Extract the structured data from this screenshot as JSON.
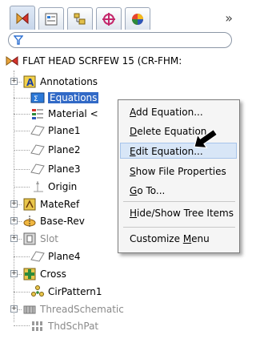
{
  "toolbar": {
    "tabs": [
      "feature-manager",
      "property-manager",
      "configuration-manager",
      "dimxpert-manager",
      "display-manager"
    ],
    "more_label": "»"
  },
  "tree": {
    "root_label": "FLAT HEAD SCRFEW 15  (CR-FHM:",
    "items": [
      {
        "label": "Annotations",
        "icon": "annotations-icon"
      },
      {
        "label": "Equations",
        "icon": "equations-icon",
        "selected": true
      },
      {
        "label": "Material <",
        "icon": "material-icon"
      },
      {
        "label": "Plane1",
        "icon": "plane-icon"
      },
      {
        "label": "Plane2",
        "icon": "plane-icon"
      },
      {
        "label": "Plane3",
        "icon": "plane-icon"
      },
      {
        "label": "Origin",
        "icon": "origin-icon"
      },
      {
        "label": "MateRef",
        "icon": "materef-icon"
      },
      {
        "label": "Base-Rev",
        "icon": "revolve-icon"
      },
      {
        "label": "Slot",
        "icon": "cut-icon"
      },
      {
        "label": "Plane4",
        "icon": "plane-icon"
      },
      {
        "label": "Cross",
        "icon": "cross-feature-icon"
      },
      {
        "label": "CirPattern1",
        "icon": "circular-pattern-icon"
      },
      {
        "label": "ThreadSchematic",
        "icon": "thread-icon",
        "dimmed": true
      },
      {
        "label": "ThdSchPat",
        "icon": "pattern-icon",
        "dimmed": true
      }
    ]
  },
  "context_menu": {
    "items": [
      {
        "label": "Add Equation...",
        "accel": "A"
      },
      {
        "label": "Delete Equation...",
        "accel": "D"
      },
      {
        "label": "Edit Equation...",
        "accel": "E",
        "highlighted": true
      },
      {
        "label": "Show File Properties",
        "accel": "S"
      },
      {
        "label": "Go To...",
        "accel": "G"
      },
      {
        "label": "Hide/Show Tree Items",
        "accel": "H"
      },
      {
        "label": "Customize Menu",
        "accel": "M"
      }
    ]
  }
}
